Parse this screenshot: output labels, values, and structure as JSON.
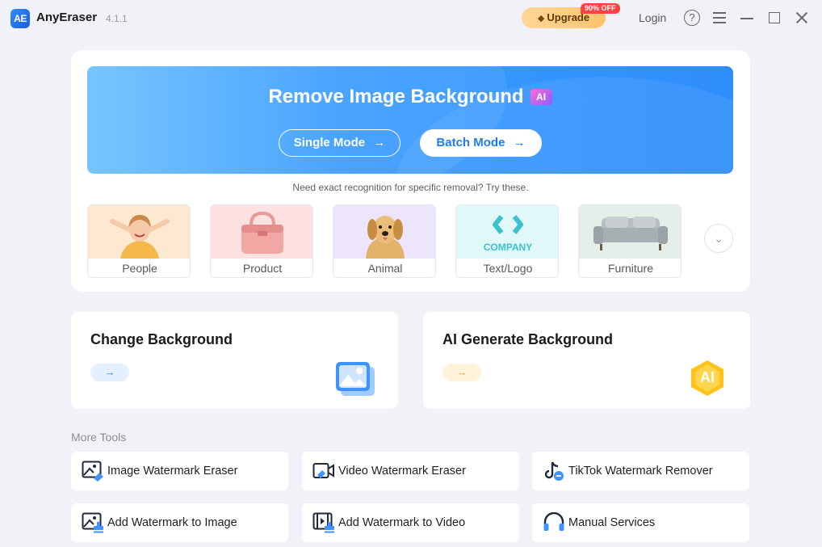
{
  "titlebar": {
    "logo_text": "AE",
    "app_name": "AnyEraser",
    "version": "4.1.1",
    "upgrade_label": "Upgrade",
    "discount_badge": "90% OFF",
    "login_label": "Login",
    "help_glyph": "?"
  },
  "hero": {
    "title": "Remove Image Background",
    "ai_tag": "AI",
    "single_mode_label": "Single Mode",
    "batch_mode_label": "Batch Mode",
    "arrow_glyph": "→",
    "hint": "Need exact recognition for specific removal? Try these."
  },
  "categories": [
    {
      "label": "People"
    },
    {
      "label": "Product"
    },
    {
      "label": "Animal"
    },
    {
      "label": "Text/Logo",
      "thumb_text": "COMPANY"
    },
    {
      "label": "Furniture"
    }
  ],
  "features": [
    {
      "title": "Change Background",
      "arrow": "→"
    },
    {
      "title": "AI Generate Background",
      "arrow": "→",
      "badge": "AI"
    }
  ],
  "more_tools": {
    "title": "More Tools",
    "items": [
      {
        "label": "Image Watermark Eraser"
      },
      {
        "label": "Video Watermark Eraser"
      },
      {
        "label": "TikTok Watermark Remover"
      },
      {
        "label": "Add Watermark to Image"
      },
      {
        "label": "Add Watermark to Video"
      },
      {
        "label": "Manual Services"
      }
    ]
  },
  "colors": {
    "accent": "#2e8dfb",
    "upgrade": "#ffc46b",
    "badge_red": "#ff4242"
  }
}
